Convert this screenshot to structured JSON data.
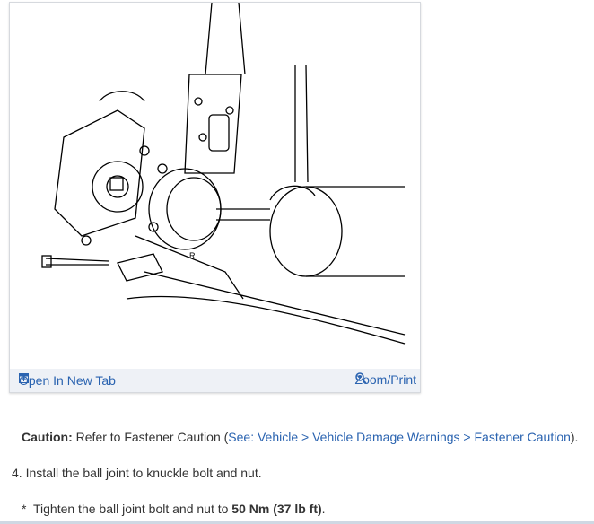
{
  "figure": {
    "open_label": "Open In New Tab",
    "zoom_label": "Zoom/Print",
    "drawing_label": "R"
  },
  "caution": {
    "label": "Caution:",
    "text": " Refer to Fastener Caution (",
    "link": "See: Vehicle > Vehicle Damage Warnings > Fastener Caution",
    "end": ")."
  },
  "step": {
    "text": "4. Install the ball joint to knuckle bolt and nut."
  },
  "substep": {
    "bullet": "*",
    "text": "Tighten the ball joint bolt and nut to ",
    "value": "50 Nm (37 lb ft)",
    "end": "."
  },
  "colors": {
    "link": "#2a63b0",
    "footer": "#eef1f6"
  }
}
